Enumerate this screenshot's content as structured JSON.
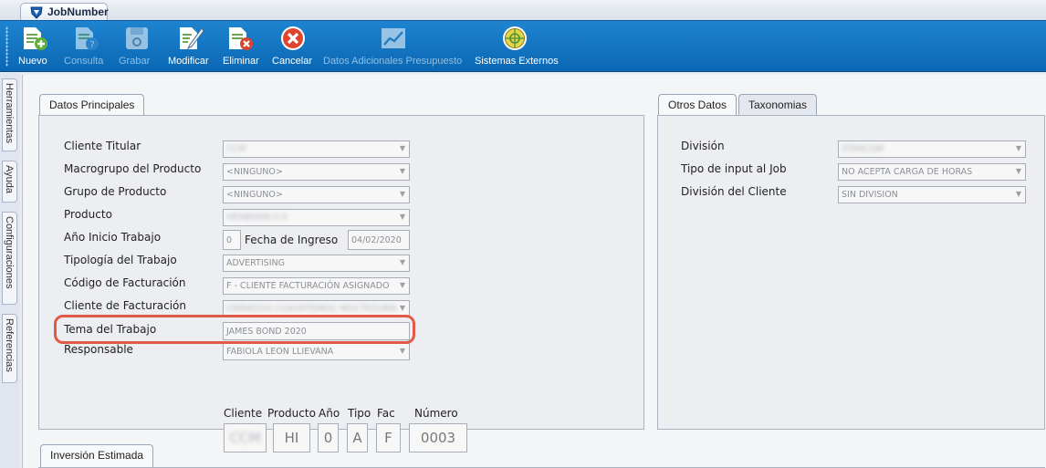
{
  "app_tab": {
    "label": "JobNumber"
  },
  "toolbar": {
    "buttons": [
      {
        "label": "Nuevo",
        "icon": "new-doc-icon",
        "enabled": true
      },
      {
        "label": "Consulta",
        "icon": "query-doc-icon",
        "enabled": false
      },
      {
        "label": "Grabar",
        "icon": "save-disk-icon",
        "enabled": false
      },
      {
        "label": "Modificar",
        "icon": "edit-doc-icon",
        "enabled": true
      },
      {
        "label": "Eliminar",
        "icon": "delete-doc-icon",
        "enabled": true
      },
      {
        "label": "Cancelar",
        "icon": "cancel-circle-icon",
        "enabled": true
      },
      {
        "label": "Datos Adicionales Presupuesto",
        "icon": "chart-line-icon",
        "enabled": false
      },
      {
        "label": "Sistemas Externos",
        "icon": "globe-icon",
        "enabled": true
      }
    ]
  },
  "side_tabs": [
    "Herramientas",
    "Ayuda",
    "Configuraciones",
    "Referencias"
  ],
  "main_panel": {
    "tab": "Datos Principales",
    "fields": {
      "cliente_titular": {
        "label": "Cliente Titular",
        "value": "CCM"
      },
      "macrogrupo": {
        "label": "Macrogrupo del Producto",
        "value": "<NINGUNO>"
      },
      "grupo": {
        "label": "Grupo de Producto",
        "value": "<NINGUNO>"
      },
      "producto": {
        "label": "Producto",
        "value": "HEINEKEN 0.0"
      },
      "anio_inicio": {
        "label": "Año Inicio Trabajo",
        "value": "0"
      },
      "fecha_ingreso": {
        "label": "Fecha de Ingreso",
        "value": "04/02/2020"
      },
      "tipologia": {
        "label": "Tipología del Trabajo",
        "value": "ADVERTISING"
      },
      "codigo_facturacion": {
        "label": "Código de Facturación",
        "value": "F - CLIENTE FACTURACIÓN ASIGNADO"
      },
      "cliente_facturacion": {
        "label": "Cliente de Facturación",
        "value": "CERVEZAS CUAUHTEMOC MOCTEZUMA"
      },
      "tema": {
        "label": "Tema del Trabajo",
        "value": "JAMES BOND 2020"
      },
      "responsable": {
        "label": "Responsable",
        "value": "FABIOLA LEON LLIEVANA"
      }
    },
    "code": {
      "headers": [
        "Cliente",
        "Producto",
        "Año",
        "Tipo",
        "Fac",
        "Número"
      ],
      "values": [
        "CCM",
        "HI",
        "0",
        "A",
        "F",
        "0003"
      ]
    }
  },
  "right_panel": {
    "tabs": [
      "Otros Datos",
      "Taxonomias"
    ],
    "fields": {
      "division": {
        "label": "División",
        "value": "STARCOM"
      },
      "tipo_input": {
        "label": "Tipo de input al Job",
        "value": "NO ACEPTA CARGA DE HORAS"
      },
      "division_cliente": {
        "label": "División del Cliente",
        "value": "SIN DIVISION"
      }
    }
  },
  "bottom_panel": {
    "tab": "Inversión Estimada"
  },
  "colors": {
    "toolbar": "#0b67b4",
    "highlight": "#e05a45"
  }
}
